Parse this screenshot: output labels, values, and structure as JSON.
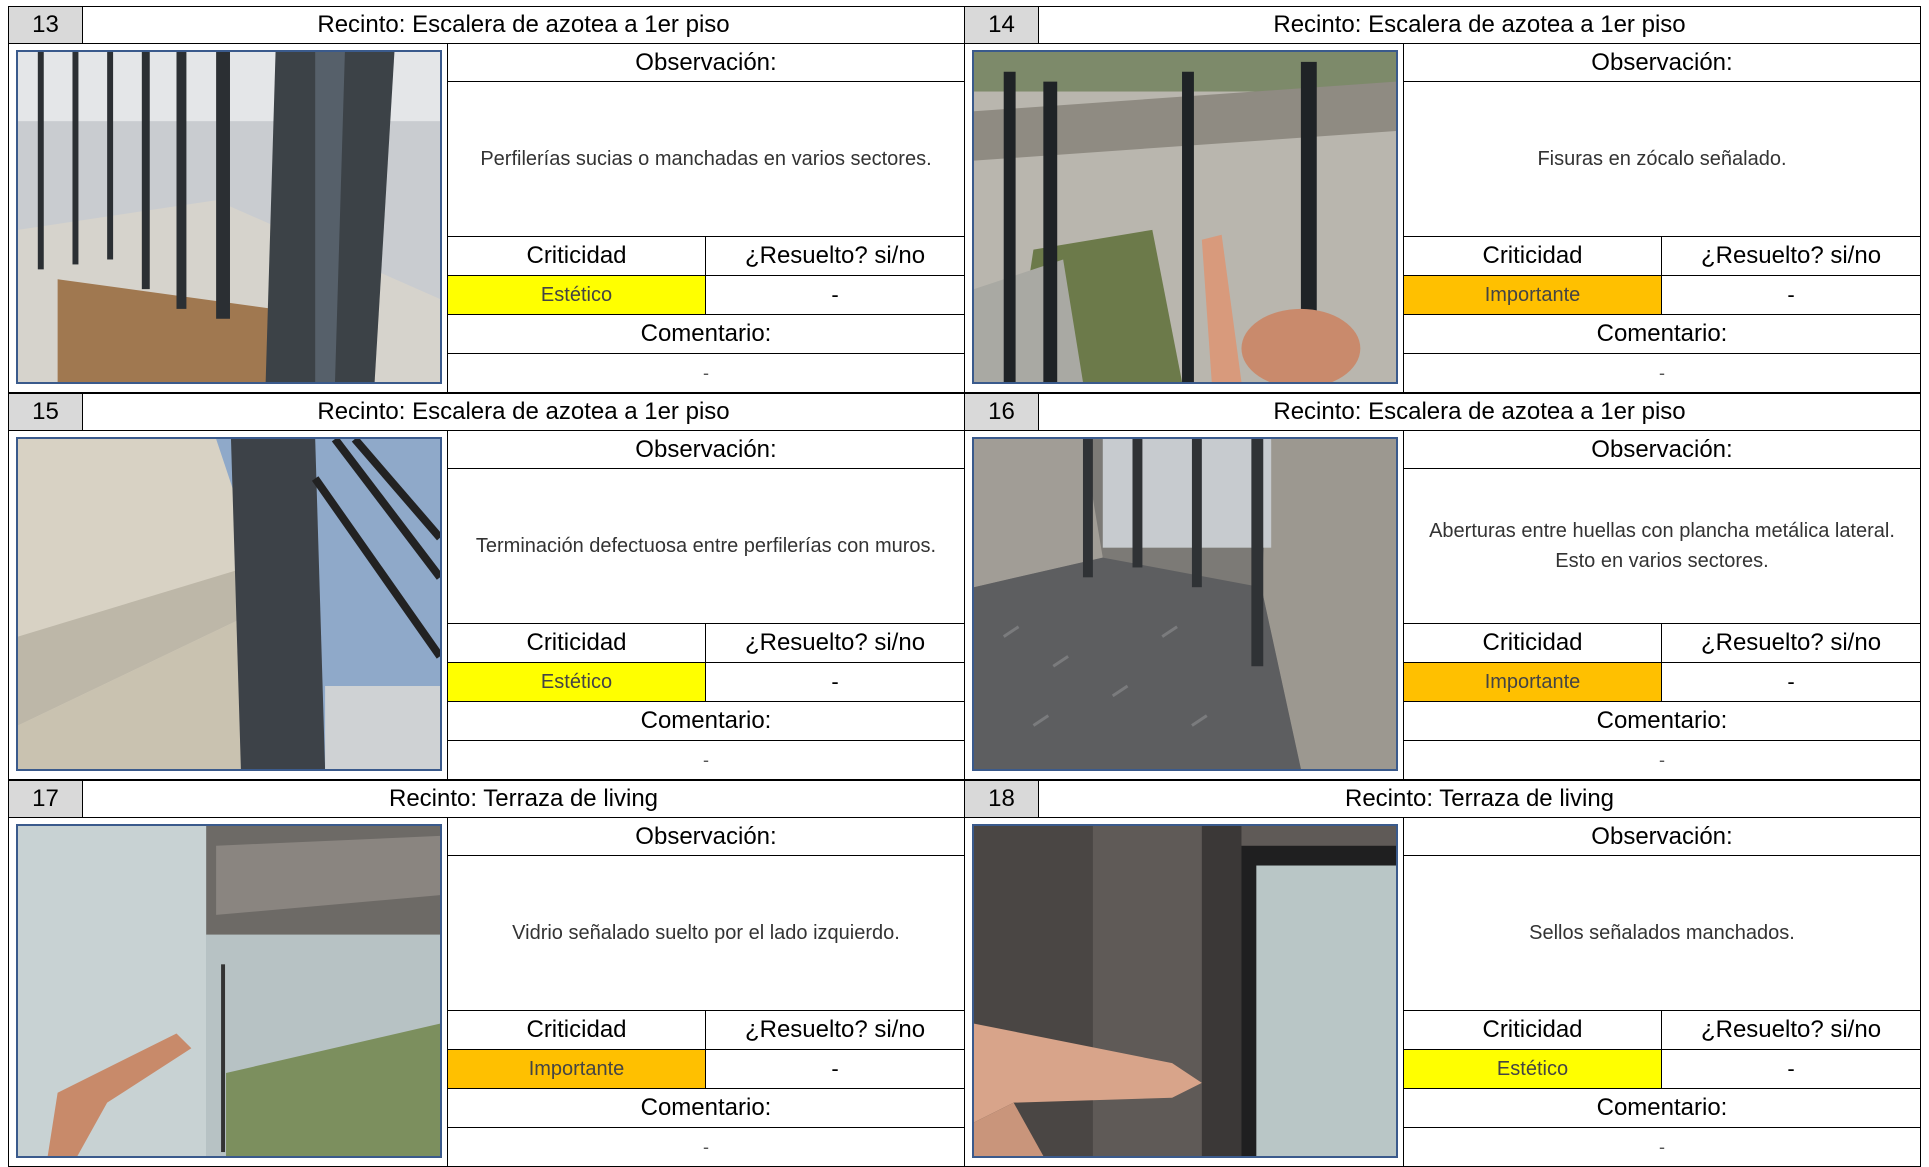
{
  "labels": {
    "observacion": "Observación:",
    "criticidad": "Criticidad",
    "resuelto": "¿Resuelto? si/no",
    "comentario": "Comentario:"
  },
  "colors": {
    "estetico": "#ffff00",
    "importante": "#ffc000",
    "header_num_bg": "#d9d9d9",
    "photo_border": "#3a5a8c"
  },
  "items": [
    {
      "num": "13",
      "recinto": "Recinto: Escalera de azotea a 1er piso",
      "observacion": "Perfilerías sucias o manchadas en varios sectores.",
      "criticidad": "Estético",
      "criticidad_color": "#ffff00",
      "resuelto": "-",
      "comentario": "-",
      "photo": "railing-photo"
    },
    {
      "num": "14",
      "recinto": "Recinto: Escalera de azotea a 1er piso",
      "observacion": "Fisuras en zócalo señalado.",
      "criticidad": "Importante",
      "criticidad_color": "#ffc000",
      "resuelto": "-",
      "comentario": "-",
      "photo": "wall-crack-photo"
    },
    {
      "num": "15",
      "recinto": "Recinto: Escalera de azotea a 1er piso",
      "observacion": "Terminación defectuosa entre perfilerías con muros.",
      "criticidad": "Estético",
      "criticidad_color": "#ffff00",
      "resuelto": "-",
      "comentario": "-",
      "photo": "wall-junction-photo"
    },
    {
      "num": "16",
      "recinto": "Recinto: Escalera de azotea a 1er piso",
      "observacion": "Aberturas entre huellas con plancha metálica lateral. Esto en varios sectores.",
      "criticidad": "Importante",
      "criticidad_color": "#ffc000",
      "resuelto": "-",
      "comentario": "-",
      "photo": "metal-step-photo"
    },
    {
      "num": "17",
      "recinto": "Recinto: Terraza de living",
      "observacion": "Vidrio señalado suelto por el lado izquierdo.",
      "criticidad": "Importante",
      "criticidad_color": "#ffc000",
      "resuelto": "-",
      "comentario": "-",
      "photo": "glass-railing-photo"
    },
    {
      "num": "18",
      "recinto": "Recinto: Terraza de living",
      "observacion": "Sellos señalados manchados.",
      "criticidad": "Estético",
      "criticidad_color": "#ffff00",
      "resuelto": "-",
      "comentario": "-",
      "photo": "window-seal-photo"
    }
  ]
}
